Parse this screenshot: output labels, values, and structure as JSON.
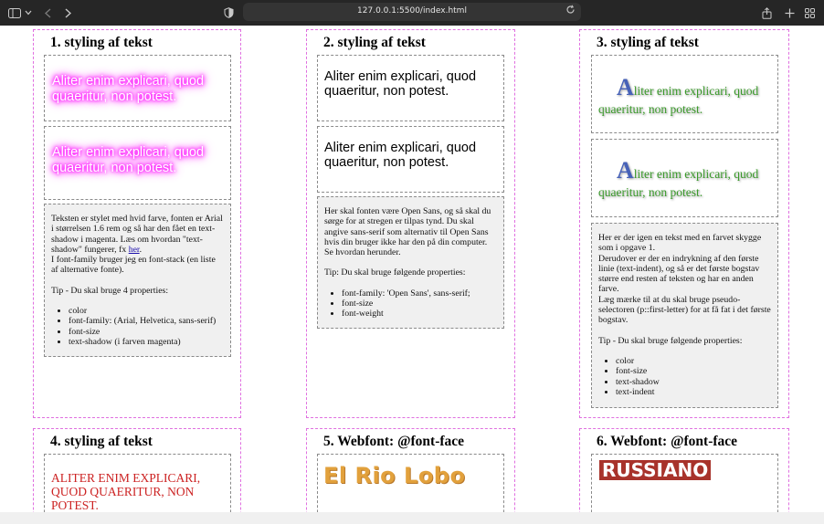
{
  "browser": {
    "url": "127.0.0.1:5500/index.html",
    "icons": [
      "sidebar-icon",
      "chevron-down-icon",
      "back-icon",
      "forward-icon",
      "shield-icon",
      "reload-icon",
      "share-icon",
      "new-tab-icon",
      "tab-overview-icon"
    ]
  },
  "colors": {
    "frame_border": "#e070e0",
    "glow": "#ff00ff",
    "green_text": "#3a9a2a",
    "drop_cap": "#4762b8",
    "red_text": "#cc2222",
    "rio": "#e2a13c",
    "russ_bg": "#a8332b"
  },
  "sample_text": "Aliter enim explicari, quod quaeritur, non potest.",
  "sample_text_cap": "A",
  "sample_text_rest": "liter enim explicari, quod quaeritur, non potest.",
  "col1": {
    "title": "1. styling af tekst",
    "note": {
      "p1": "Teksten er stylet med hvid farve, fonten er Arial i størrelsen 1.6 rem og så har den fået en text-shadow i magenta. Læs om hvordan \"text-shadow\" fungerer, fx ",
      "link": "her",
      "p1_end": ".",
      "p2": "I font-family bruger jeg en font-stack (en liste af alternative fonte).",
      "tip": "Tip - Du skal bruge 4 properties:",
      "items": [
        "color",
        "font-family: (Arial, Helvetica, sans-serif)",
        "font-size",
        "text-shadow (i farven magenta)"
      ]
    }
  },
  "col2": {
    "title": "2. styling af tekst",
    "note": {
      "p1": "Her skal fonten være Open Sans, og så skal du sørge for at stregen er tilpas tynd. Du skal angive sans-serif som alternativ til Open Sans hvis din bruger ikke har den på din computer. Se hvordan herunder.",
      "tip": "Tip: Du skal bruge følgende properties:",
      "items": [
        "font-family: 'Open Sans', sans-serif;",
        "font-size",
        "font-weight"
      ]
    }
  },
  "col3": {
    "title": "3. styling af tekst",
    "note": {
      "p1": "Her er der igen en tekst med en farvet skygge som i opgave 1.",
      "p2": "Derudover er der en indrykning af den første linie (text-indent), og så er det første bogstav større end resten af teksten og har en anden farve.",
      "p3": "Læg mærke til at du skal bruge pseudo-selectoren (p::first-letter) for at få fat i det første bogstav.",
      "tip": "Tip - Du skal bruge følgende properties:",
      "items": [
        "color",
        "font-size",
        "text-shadow",
        "text-indent"
      ]
    }
  },
  "col4": {
    "title": "4. styling af tekst"
  },
  "col5": {
    "title": "5. Webfont: @font-face",
    "sample": "El Rio Lobo"
  },
  "col6": {
    "title": "6. Webfont: @font-face",
    "sample": "RUSSIANO"
  }
}
